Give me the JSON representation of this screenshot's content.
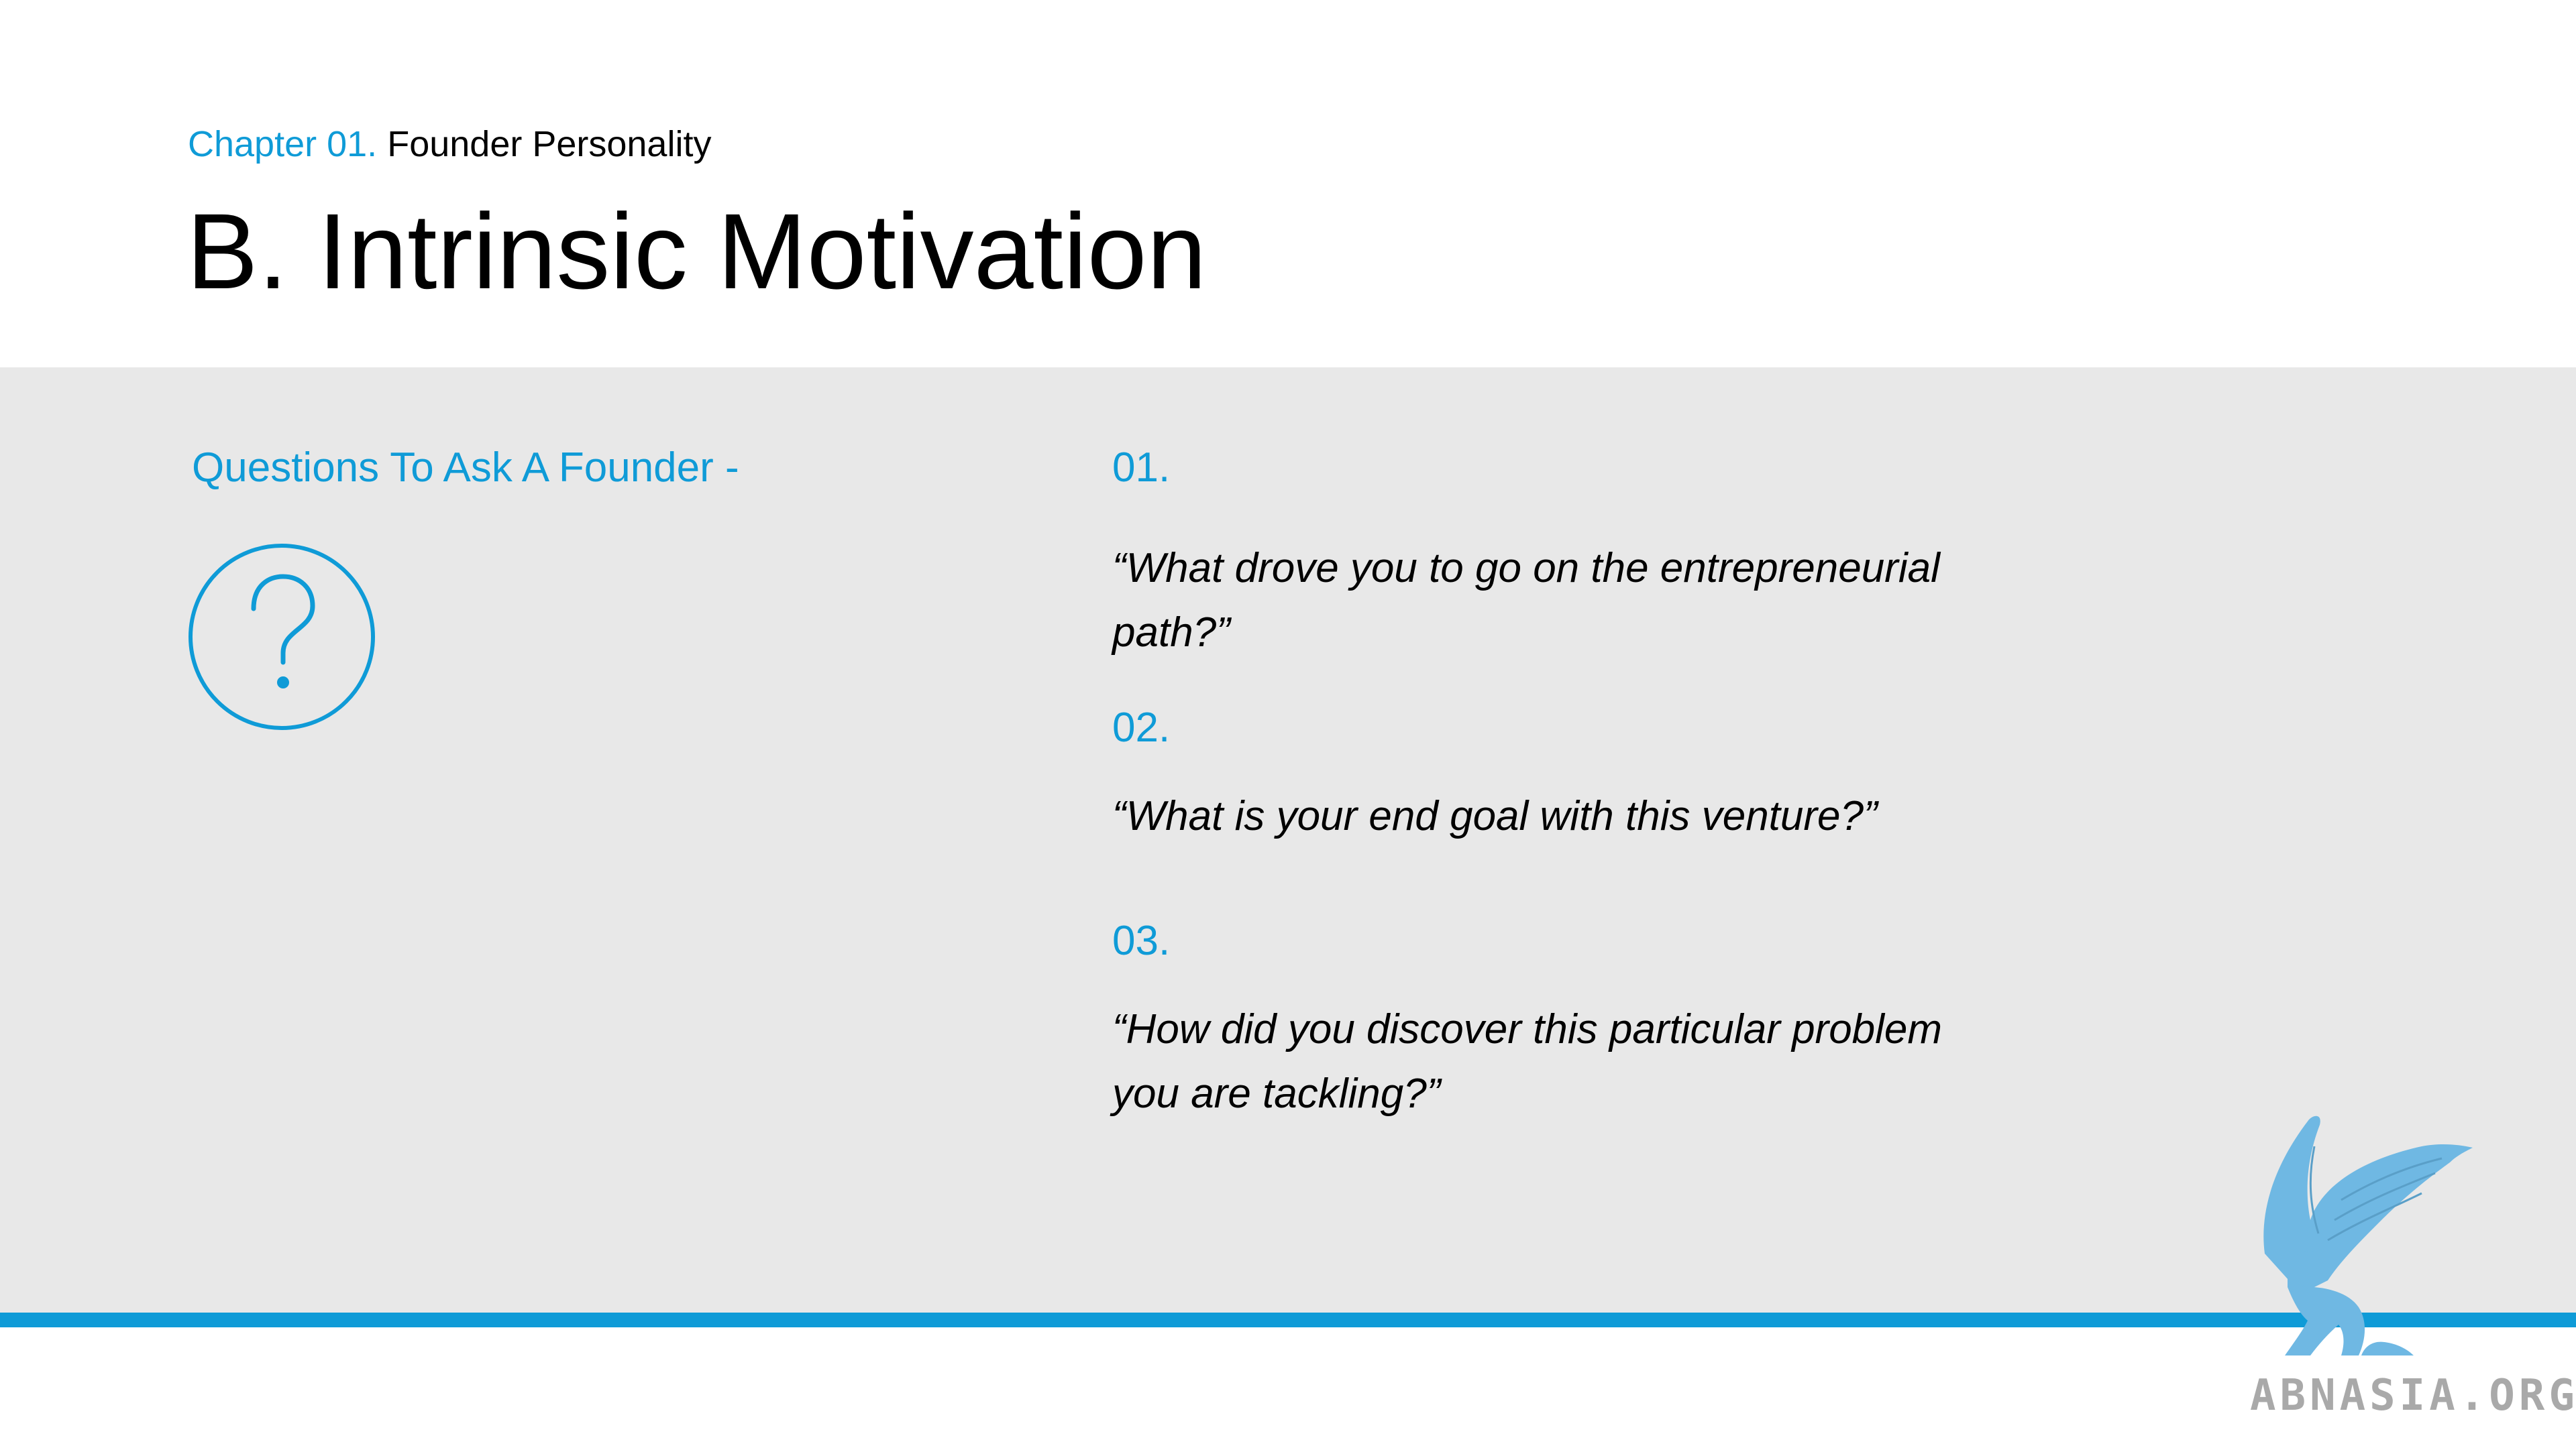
{
  "header": {
    "chapter_prefix": "Chapter 01.",
    "chapter_title": "Founder Personality",
    "title": "B. Intrinsic Motivation"
  },
  "section": {
    "heading": "Questions To Ask A Founder -",
    "icon": "question-circle-icon"
  },
  "questions": [
    {
      "number": "01.",
      "text": "“What drove you to go on the entrepreneurial path?”"
    },
    {
      "number": "02.",
      "text": "“What is your end goal with this venture?”"
    },
    {
      "number": "03.",
      "text": "“How did you discover this particular problem you are tackling?”"
    }
  ],
  "logo": {
    "text": "ABNASIA.ORG",
    "icon": "griffin-logo-icon"
  },
  "colors": {
    "accent": "#0f9bd7",
    "content_background": "#e8e8e8",
    "text": "#000000",
    "logo_text": "#a9a9a9",
    "logo_mark": "#6fb8e3"
  }
}
